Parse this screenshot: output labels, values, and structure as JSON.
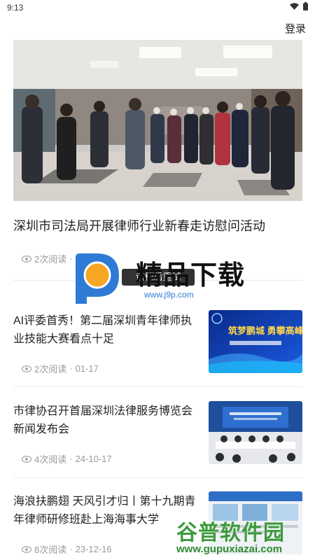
{
  "status": {
    "time": "9:13"
  },
  "header": {
    "login_label": "登录"
  },
  "featured": {
    "title": "深圳市司法局开展律师行业新春走访慰问活动",
    "reads": "2次阅读",
    "date": ""
  },
  "articles": [
    {
      "title": "AI评委首秀！第二届深圳青年律师执业技能大赛看点十足",
      "reads": "2次阅读",
      "date": "01-17",
      "thumb_text": "筑梦鹏城 勇攀高峰"
    },
    {
      "title": "市律协召开首届深圳法律服务博览会新闻发布会",
      "reads": "4次阅读",
      "date": "24-10-17"
    },
    {
      "title": "海浪扶鹏翅 天风引才归丨第十九期青年律师研修班赴上海海事大学",
      "reads": "8次阅读",
      "date": "23-12-16"
    }
  ],
  "meta_separator": "·",
  "watermarks": {
    "top_brand": "精品下载",
    "top_url": "www.j9p.com",
    "top_chip": "请稍后重试",
    "bottom_brand": "谷普软件园",
    "bottom_url": "www.gupuxiazai.com"
  },
  "colors": {
    "text": "#222222",
    "meta": "#999999",
    "divider": "#ececec"
  }
}
